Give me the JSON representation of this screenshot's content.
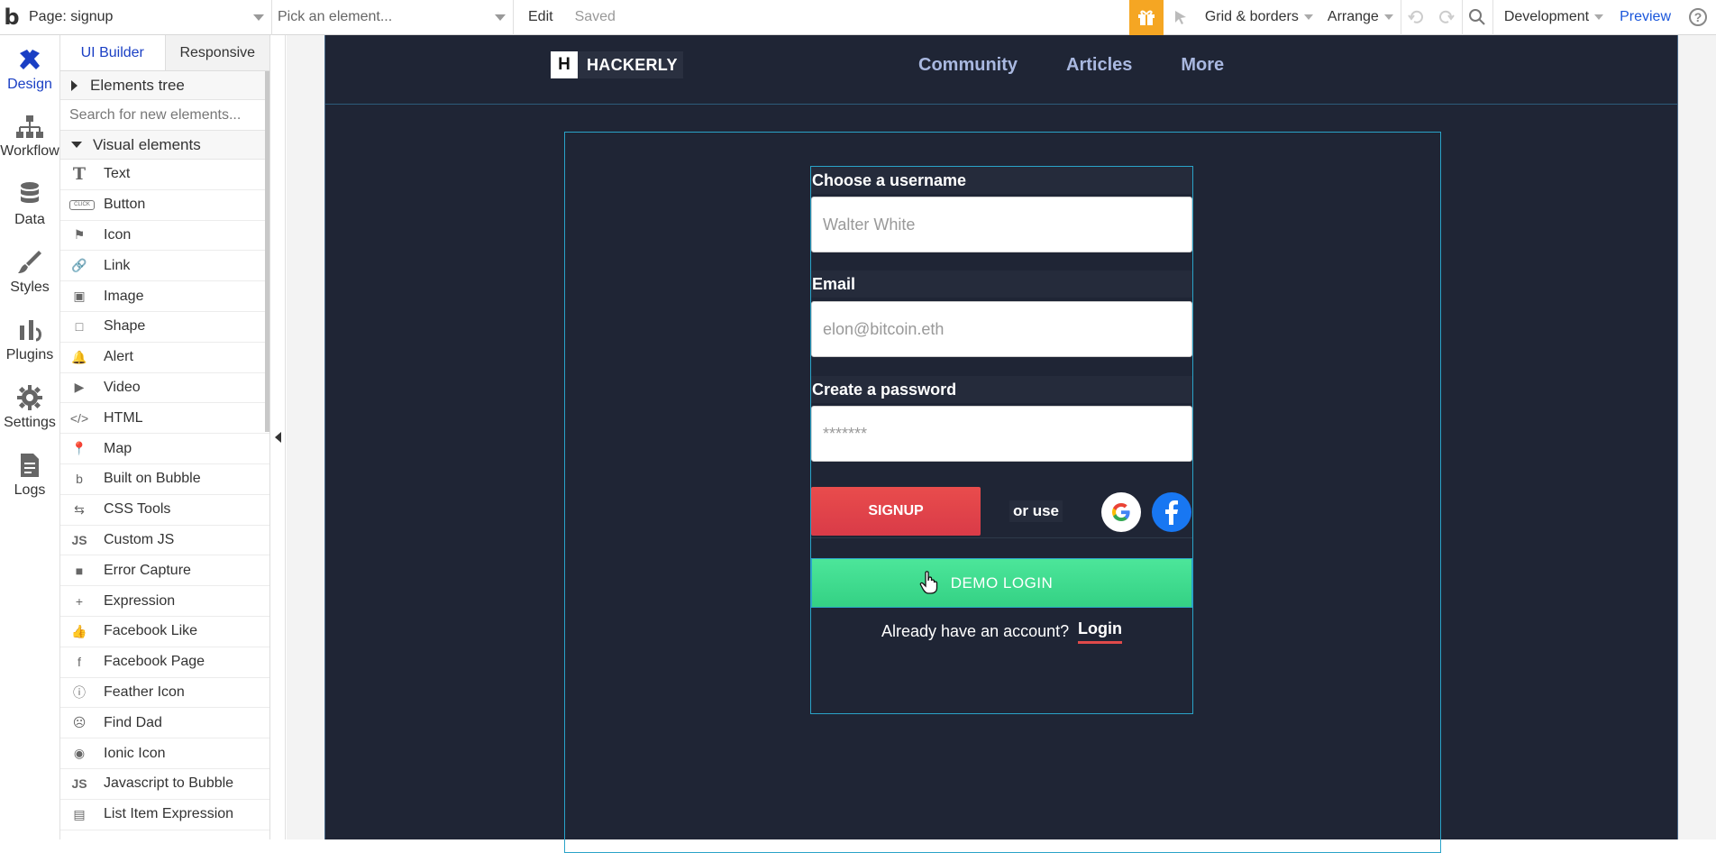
{
  "topbar": {
    "page_select": "Page: signup",
    "element_pick": "Pick an element...",
    "edit": "Edit",
    "saved": "Saved",
    "grid_borders": "Grid & borders",
    "arrange": "Arrange",
    "environment": "Development",
    "preview": "Preview",
    "help": "?"
  },
  "rail": [
    {
      "label": "Design",
      "icon": "design-icon"
    },
    {
      "label": "Workflow",
      "icon": "workflow-icon"
    },
    {
      "label": "Data",
      "icon": "database-icon"
    },
    {
      "label": "Styles",
      "icon": "brush-icon"
    },
    {
      "label": "Plugins",
      "icon": "plugin-icon"
    },
    {
      "label": "Settings",
      "icon": "gear-icon"
    },
    {
      "label": "Logs",
      "icon": "document-icon"
    }
  ],
  "panel": {
    "tab_ui_builder": "UI Builder",
    "tab_responsive": "Responsive",
    "elements_tree": "Elements tree",
    "search_placeholder": "Search for new elements...",
    "visual_elements": "Visual elements",
    "items": [
      {
        "label": "Text",
        "icon": "T"
      },
      {
        "label": "Button",
        "icon": "CLICK"
      },
      {
        "label": "Icon",
        "icon": "⚑"
      },
      {
        "label": "Link",
        "icon": "🔗"
      },
      {
        "label": "Image",
        "icon": "▣"
      },
      {
        "label": "Shape",
        "icon": "□"
      },
      {
        "label": "Alert",
        "icon": "🔔"
      },
      {
        "label": "Video",
        "icon": "▶"
      },
      {
        "label": "HTML",
        "icon": "</>"
      },
      {
        "label": "Map",
        "icon": "📍"
      },
      {
        "label": "Built on Bubble",
        "icon": "b"
      },
      {
        "label": "CSS Tools",
        "icon": "⇆"
      },
      {
        "label": "Custom JS",
        "icon": "JS"
      },
      {
        "label": "Error Capture",
        "icon": "■"
      },
      {
        "label": "Expression",
        "icon": "+"
      },
      {
        "label": "Facebook Like",
        "icon": "👍"
      },
      {
        "label": "Facebook Page",
        "icon": "f"
      },
      {
        "label": "Feather Icon",
        "icon": "ⓘ"
      },
      {
        "label": "Find Dad",
        "icon": "☹"
      },
      {
        "label": "Ionic Icon",
        "icon": "◉"
      },
      {
        "label": "Javascript to Bubble",
        "icon": "JS"
      },
      {
        "label": "List Item Expression",
        "icon": "▤"
      }
    ]
  },
  "site": {
    "brand_letter": "H",
    "brand_name": "HACKERLY",
    "nav": [
      "Community",
      "Articles",
      "More"
    ]
  },
  "form": {
    "username_label": "Choose a username",
    "username_placeholder": "Walter White",
    "email_label": "Email",
    "email_placeholder": "elon@bitcoin.eth",
    "password_label": "Create a password",
    "password_placeholder": "*******",
    "signup": "SIGNUP",
    "or_use": "or use",
    "demo_login": "DEMO LOGIN",
    "already": "Already have an account?",
    "login": "Login"
  },
  "colors": {
    "page_bg": "#1f2535",
    "signup_red": "#e04a4a",
    "demo_green": "#3ddc8c",
    "accent_blue": "#1a3fc4"
  }
}
